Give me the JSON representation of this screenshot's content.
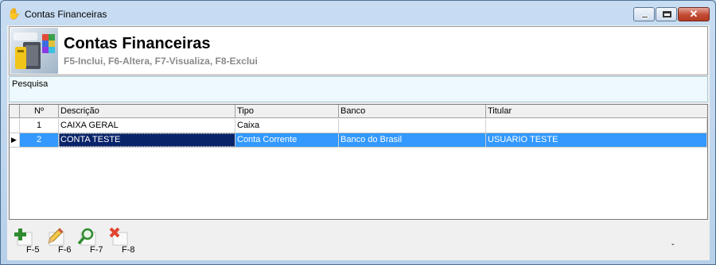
{
  "window": {
    "title": "Contas Financeiras",
    "close_glyph": "✕"
  },
  "header": {
    "title": "Contas Financeiras",
    "subtitle": "F5-Inclui, F6-Altera, F7-Visualiza, F8-Exclui"
  },
  "search": {
    "label": "Pesquisa"
  },
  "grid": {
    "columns": [
      "Nº",
      "Descrição",
      "Tipo",
      "Banco",
      "Titular"
    ],
    "rows": [
      {
        "num": "1",
        "descricao": "CAIXA GERAL",
        "tipo": "Caixa",
        "banco": "",
        "titular": ""
      },
      {
        "num": "2",
        "descricao": "CONTA TESTE",
        "tipo": "Conta Corrente",
        "banco": "Banco do Brasil",
        "titular": "USUARIO TESTE"
      }
    ],
    "selected_row": 2,
    "indicator": "▶"
  },
  "toolbar": {
    "buttons": [
      {
        "key": "F-5",
        "icon": "add-icon"
      },
      {
        "key": "F-6",
        "icon": "pencil-icon"
      },
      {
        "key": "F-7",
        "icon": "magnifier-icon"
      },
      {
        "key": "F-8",
        "icon": "delete-icon"
      }
    ]
  },
  "status": {
    "text": "-"
  },
  "colors": {
    "selection": "#3399ff",
    "focused_cell": "#0a246a",
    "search_panel": "#eef9fd"
  }
}
